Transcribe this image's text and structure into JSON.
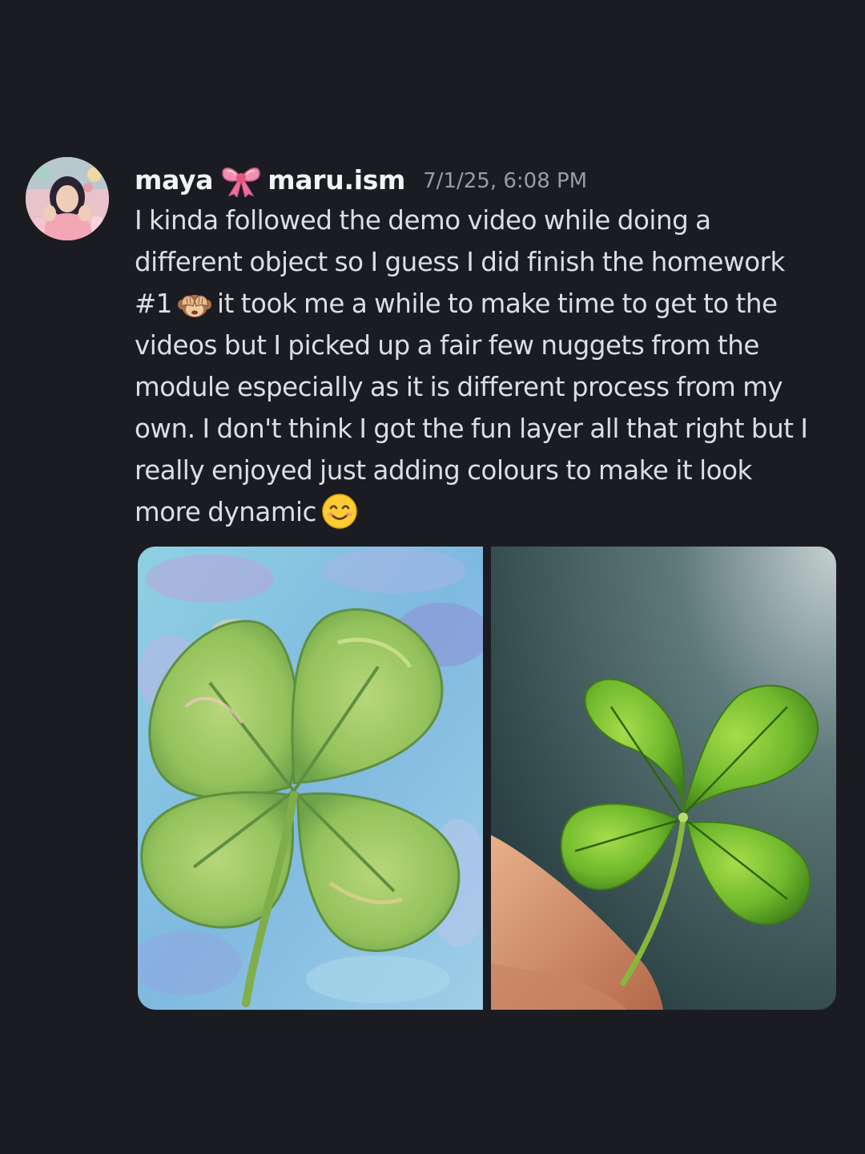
{
  "message": {
    "author": {
      "display_name": "maya",
      "decoration_icon": "ribbon-bow-icon",
      "handle": "maru.ism",
      "avatar_icon": "user-avatar"
    },
    "timestamp": "7/1/25, 6:08 PM",
    "lines": [
      "I kinda followed the demo video while doing a",
      "different object so I guess I did finish the homework",
      "#1",
      "it took me a while to make time to get to the",
      "videos but I picked up a fair few nuggets from the",
      "module especially as it is different process from my",
      "own. I don't think I got the fun layer all that right but I",
      "really enjoyed just adding colours to make it look",
      "more dynamic"
    ],
    "emojis": [
      "see-no-evil-monkey-icon",
      "smiling-face-icon"
    ],
    "attachments": [
      {
        "name": "four-leaf-clover-painting",
        "kind": "image"
      },
      {
        "name": "four-leaf-clover-photo",
        "kind": "image"
      }
    ]
  },
  "colors": {
    "background": "#1b1c22",
    "text": "#dcdee3",
    "username": "#f2f3f5",
    "timestamp": "#9a9ca5"
  }
}
